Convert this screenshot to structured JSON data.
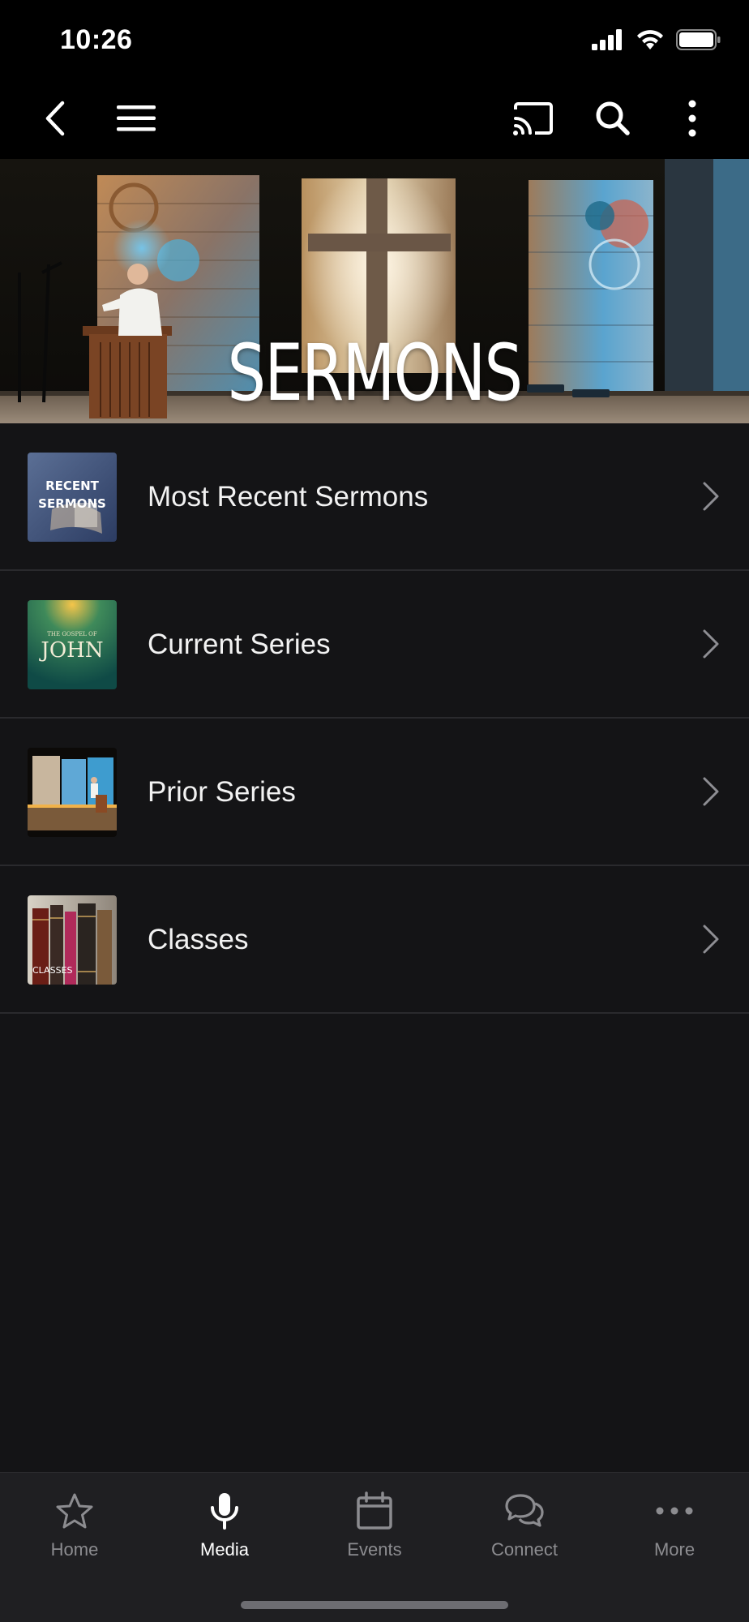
{
  "status_bar": {
    "time": "10:26"
  },
  "nav_bar": {
    "back_icon": "chevron-left-icon",
    "menu_icon": "hamburger-menu-icon",
    "cast_icon": "cast-icon",
    "search_icon": "search-icon",
    "more_icon": "vertical-ellipsis-icon"
  },
  "hero": {
    "title": "SERMONS"
  },
  "list": {
    "items": [
      {
        "label": "Most Recent Sermons",
        "thumb_text_line1": "RECENT",
        "thumb_text_line2": "SERMONS"
      },
      {
        "label": "Current Series",
        "thumb_text_small": "THE GOSPEL OF",
        "thumb_text_big": "JOHN"
      },
      {
        "label": "Prior Series"
      },
      {
        "label": "Classes",
        "thumb_text": "CLASSES"
      }
    ]
  },
  "tab_bar": {
    "tabs": [
      {
        "label": "Home",
        "icon": "star-icon",
        "active": false
      },
      {
        "label": "Media",
        "icon": "microphone-icon",
        "active": true
      },
      {
        "label": "Events",
        "icon": "calendar-icon",
        "active": false
      },
      {
        "label": "Connect",
        "icon": "chat-bubbles-icon",
        "active": false
      },
      {
        "label": "More",
        "icon": "horizontal-ellipsis-icon",
        "active": false
      }
    ]
  },
  "colors": {
    "background": "#141416",
    "bar_background": "#000000",
    "tab_bar_background": "#1f1f22",
    "active_tab": "#ffffff",
    "inactive_tab": "#8c8c90",
    "separator": "#2a2a2d"
  }
}
